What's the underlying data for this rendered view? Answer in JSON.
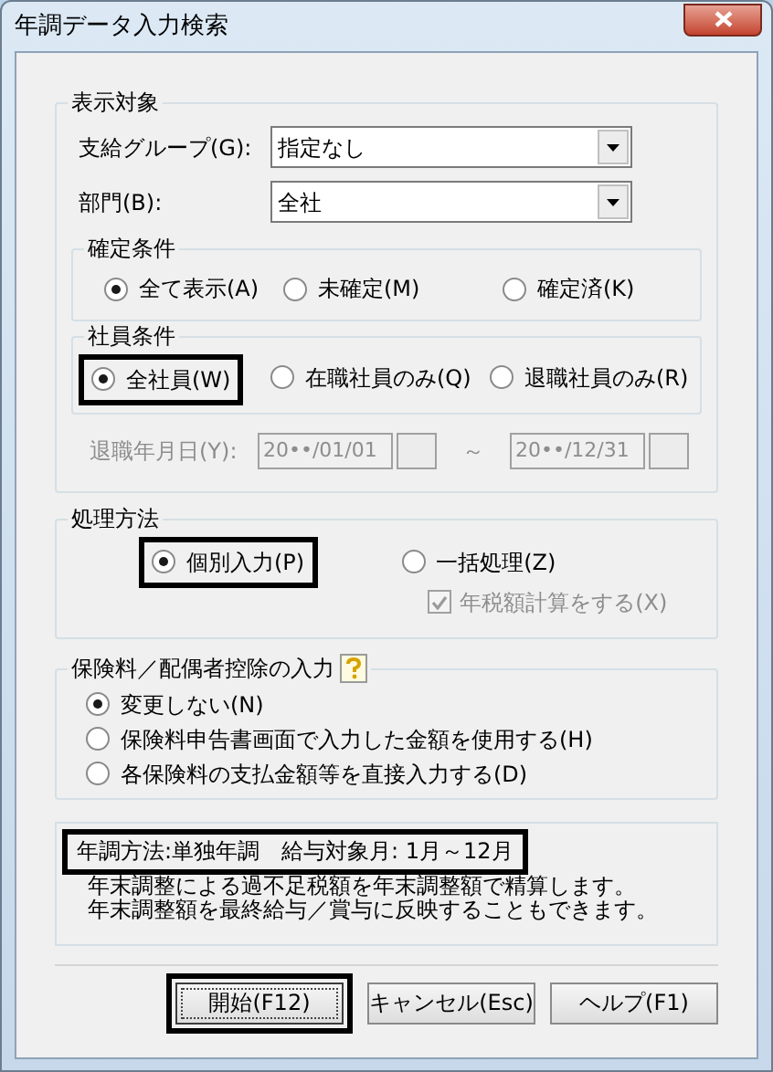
{
  "window": {
    "title": "年調データ入力検索"
  },
  "display_target": {
    "title": "表示対象",
    "fields": [
      {
        "label": "支給グループ(G):",
        "value": "指定なし"
      },
      {
        "label": "部門(B):",
        "value": "全社"
      }
    ],
    "confirm": {
      "title": "確定条件",
      "options": [
        {
          "label": "全て表示(A)",
          "selected": true,
          "highlighted": false
        },
        {
          "label": "未確定(M)",
          "selected": false,
          "highlighted": false
        },
        {
          "label": "確定済(K)",
          "selected": false,
          "highlighted": false
        }
      ]
    },
    "employee": {
      "title": "社員条件",
      "options": [
        {
          "label": "全社員(W)",
          "selected": true,
          "highlighted": true
        },
        {
          "label": "在職社員のみ(Q)",
          "selected": false,
          "highlighted": false
        },
        {
          "label": "退職社員のみ(R)",
          "selected": false,
          "highlighted": false
        }
      ]
    },
    "retire_date": {
      "label": "退職年月日(Y):",
      "from": "20••/01/01",
      "separator": "～",
      "to": "20••/12/31",
      "disabled": true
    }
  },
  "processing": {
    "title": "処理方法",
    "options": [
      {
        "label": "個別入力(P)",
        "selected": true,
        "highlighted": true
      },
      {
        "label": "一括処理(Z)",
        "selected": false,
        "highlighted": false
      }
    ],
    "tax_calc": {
      "label": "年税額計算をする(X)",
      "checked": true,
      "disabled": true
    }
  },
  "insurance": {
    "title": "保険料／配偶者控除の入力",
    "options": [
      {
        "label": "変更しない(N)",
        "selected": true
      },
      {
        "label": "保険料申告書画面で入力した金額を使用する(H)",
        "selected": false
      },
      {
        "label": "各保険料の支払金額等を直接入力する(D)",
        "selected": false
      }
    ]
  },
  "info": {
    "summary": "年調方法:単独年調　給与対象月: 1月～12月",
    "highlighted": true,
    "lines": [
      "年末調整による過不足税額を年末調整額で精算します。",
      "年末調整額を最終給与／賞与に反映することもできます。"
    ]
  },
  "buttons": [
    {
      "label": "開始(F12)",
      "default": true,
      "highlighted": true
    },
    {
      "label": "キャンセル(Esc)",
      "default": false,
      "highlighted": false
    },
    {
      "label": "ヘルプ(F1)",
      "default": false,
      "highlighted": false
    }
  ]
}
